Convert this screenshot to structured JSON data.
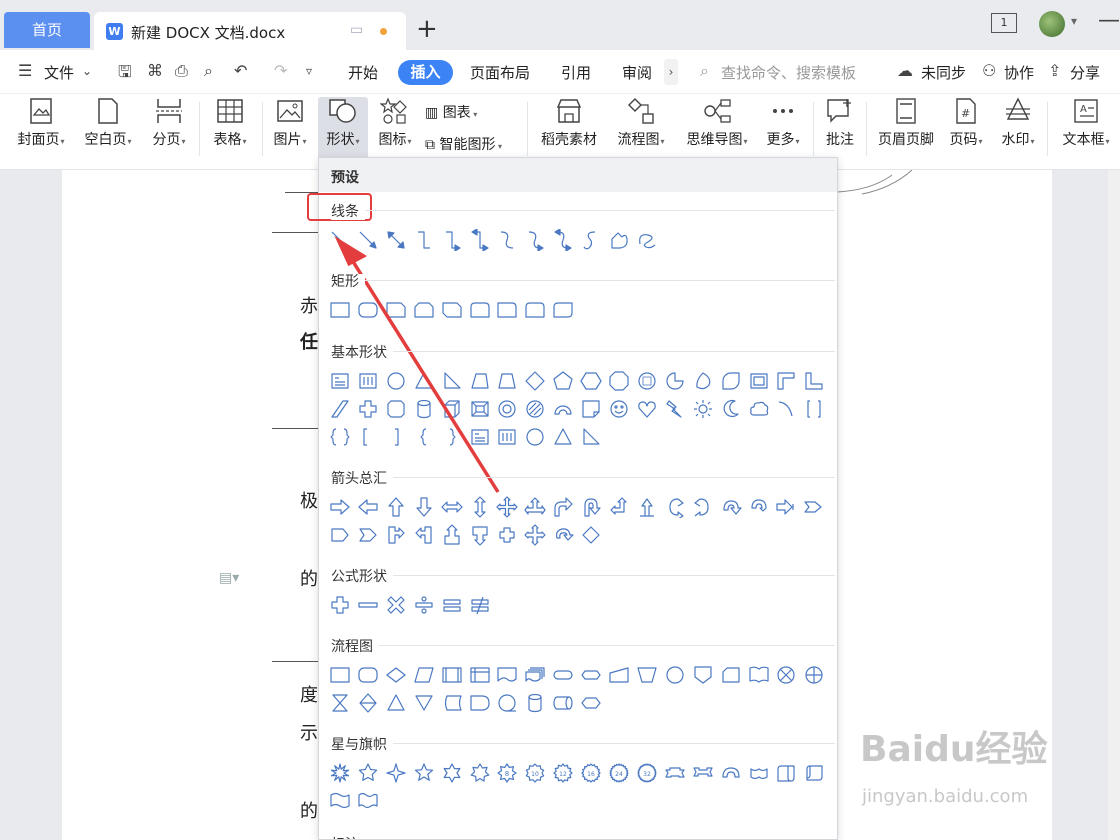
{
  "tabs": {
    "home": "首页",
    "doc": "新建 DOCX 文档.docx",
    "doc_icon": "W",
    "new_tab": "+",
    "window_count": "1"
  },
  "menu": {
    "file": "文件",
    "items": [
      "开始",
      "插入",
      "页面布局",
      "引用",
      "审阅"
    ],
    "search_placeholder": "查找命令、搜索模板",
    "unsync": "未同步",
    "collab": "协作",
    "share": "分享"
  },
  "ribbon": {
    "cover": "封面页",
    "blank": "空白页",
    "break": "分页",
    "table": "表格",
    "picture": "图片",
    "shape": "形状",
    "icon": "图标",
    "chart": "图表",
    "smart": "智能图形",
    "material": "稻壳素材",
    "flow": "流程图",
    "mind": "思维导图",
    "more": "更多",
    "comment": "批注",
    "header": "页眉页脚",
    "pagenum": "页码",
    "watermark": "水印",
    "textbox": "文本框"
  },
  "dropdown": {
    "preset": "预设",
    "sections": [
      {
        "title": "线条",
        "count": 12
      },
      {
        "title": "矩形",
        "count": 9
      },
      {
        "title": "基本形状",
        "count": 46
      },
      {
        "title": "箭头总汇",
        "count": 28
      },
      {
        "title": "公式形状",
        "count": 6
      },
      {
        "title": "流程图",
        "count": 28
      },
      {
        "title": "星与旗帜",
        "count": 20
      },
      {
        "title": "标注",
        "count": 0
      }
    ]
  },
  "doc": {
    "chars": [
      "赤",
      "任",
      "极",
      "的",
      "度",
      "示",
      "的"
    ]
  },
  "watermark": {
    "main": "Baidu经验",
    "sub": "jingyan.baidu.com"
  },
  "colors": {
    "accent": "#3c84f6",
    "highlight": "#e33d3d",
    "shape_stroke": "#4a78c2"
  }
}
